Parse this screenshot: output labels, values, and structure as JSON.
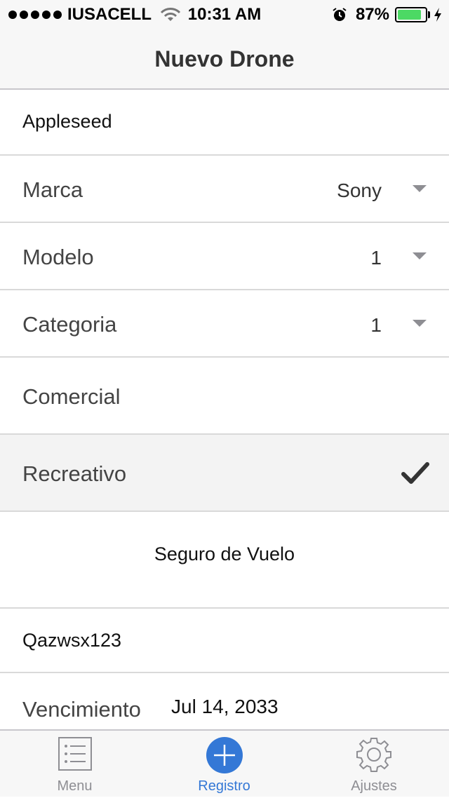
{
  "status_bar": {
    "carrier": "IUSACELL",
    "time": "10:31 AM",
    "battery": "87%",
    "battery_level": 0.87
  },
  "nav": {
    "title": "Nuevo Drone"
  },
  "form": {
    "owner_name": "Appleseed",
    "brand": {
      "label": "Marca",
      "value": "Sony"
    },
    "model": {
      "label": "Modelo",
      "value": "1"
    },
    "category": {
      "label": "Categoria",
      "value": "1"
    },
    "options": [
      {
        "label": "Comercial",
        "selected": false
      },
      {
        "label": "Recreativo",
        "selected": true
      }
    ],
    "insurance_header": "Seguro de Vuelo",
    "policy_number": "Qazwsx123",
    "expiry": {
      "label": "Vencimiento",
      "value": "Jul 14, 2033"
    }
  },
  "tabbar": {
    "tabs": [
      {
        "label": "Menu",
        "icon": "list-icon",
        "active": false
      },
      {
        "label": "Registro",
        "icon": "plus-circle-icon",
        "active": true
      },
      {
        "label": "Ajustes",
        "icon": "gear-icon",
        "active": false
      }
    ]
  },
  "colors": {
    "accent": "#3478d6",
    "battery_green": "#4cd964",
    "tab_inactive": "#8e8e93"
  }
}
